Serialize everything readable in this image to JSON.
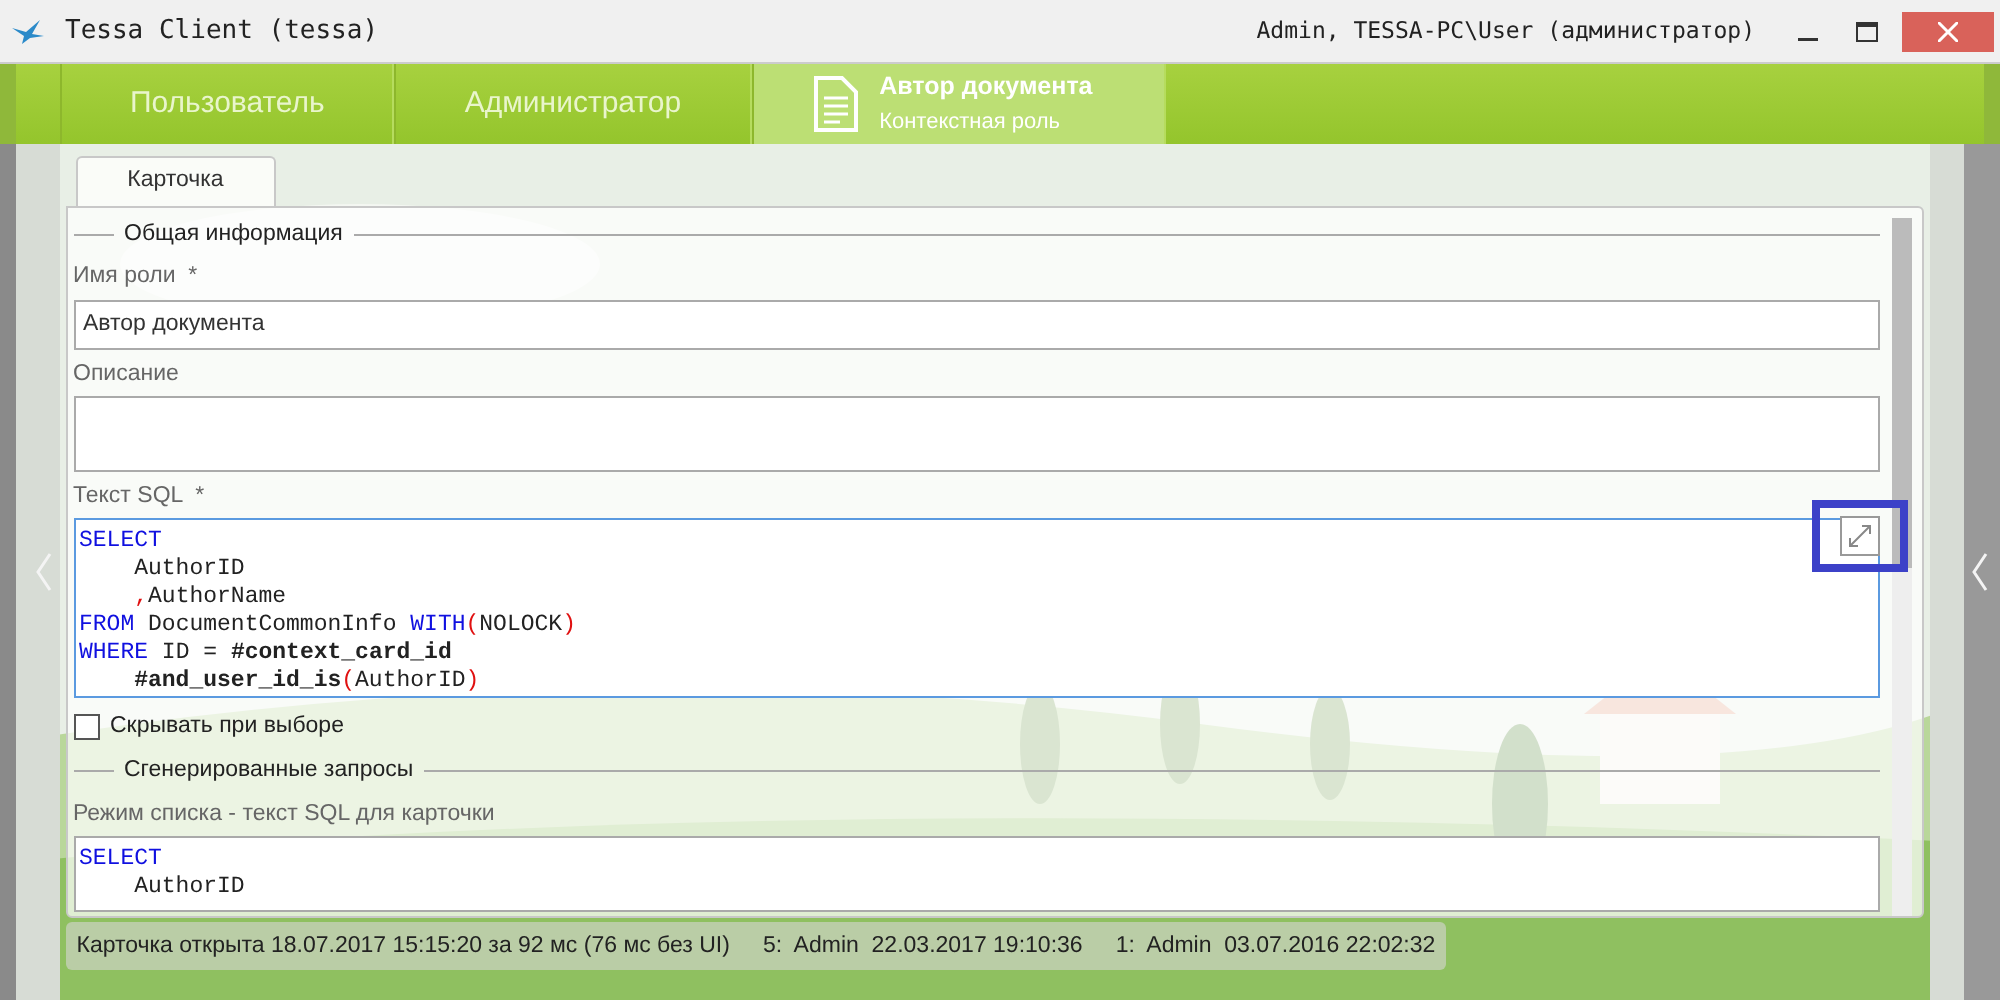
{
  "window": {
    "title": "Tessa Client (tessa)",
    "user": "Admin, TESSA-PC\\User (администратор)"
  },
  "nav_tabs": [
    {
      "label": "Пользователь",
      "selected": false
    },
    {
      "label": "Администратор",
      "selected": false
    },
    {
      "label": "Автор документа",
      "subtitle": "Контекстная роль",
      "selected": true
    }
  ],
  "card_tabs": [
    {
      "label": "Карточка",
      "selected": true
    }
  ],
  "general_group": {
    "title": "Общая информация",
    "role_name": {
      "label": "Имя роли",
      "required_mark": "*",
      "value": "Автор документа"
    },
    "description": {
      "label": "Описание"
    },
    "sql": {
      "label": "Текст SQL",
      "required_mark": "*",
      "highlighted": true,
      "lines": [
        [
          {
            "t": "SELECT",
            "kind": "keyword"
          }
        ],
        [
          {
            "t": "    AuthorID",
            "kind": "plain"
          }
        ],
        [
          {
            "t": "    ,",
            "kind": "punct"
          },
          {
            "t": "AuthorName",
            "kind": "plain"
          }
        ],
        [
          {
            "t": "FROM",
            "kind": "keyword"
          },
          {
            "t": " DocumentCommonInfo ",
            "kind": "plain"
          },
          {
            "t": "WITH",
            "kind": "keyword"
          },
          {
            "t": "(",
            "kind": "punct"
          },
          {
            "t": "NOLOCK",
            "kind": "plain"
          },
          {
            "t": ")",
            "kind": "punct"
          }
        ],
        [
          {
            "t": "WHERE",
            "kind": "keyword"
          },
          {
            "t": " ID = ",
            "kind": "plain"
          },
          {
            "t": "#context_card_id",
            "kind": "bold"
          }
        ],
        [
          {
            "t": "    #and_user_id_is",
            "kind": "bold"
          },
          {
            "t": "(",
            "kind": "punct"
          },
          {
            "t": "AuthorID",
            "kind": "plain"
          },
          {
            "t": ")",
            "kind": "punct"
          }
        ]
      ]
    },
    "hide_on_select": {
      "label": "Скрывать при выборе",
      "checked": false
    }
  },
  "generated_group": {
    "title": "Сгенерированные запросы",
    "list_mode": {
      "label": "Режим списка - текст SQL для карточки",
      "lines": [
        [
          {
            "t": "SELECT",
            "kind": "keyword"
          }
        ],
        [
          {
            "t": "    AuthorID",
            "kind": "plain"
          }
        ]
      ]
    }
  },
  "status_bar": [
    "Карточка открыта 18.07.2017 15:15:20 за 92 мс (76 мс без UI)",
    "5:  Admin  22.03.2017 19:10:36",
    "1:  Admin  03.07.2016 22:02:32"
  ]
}
